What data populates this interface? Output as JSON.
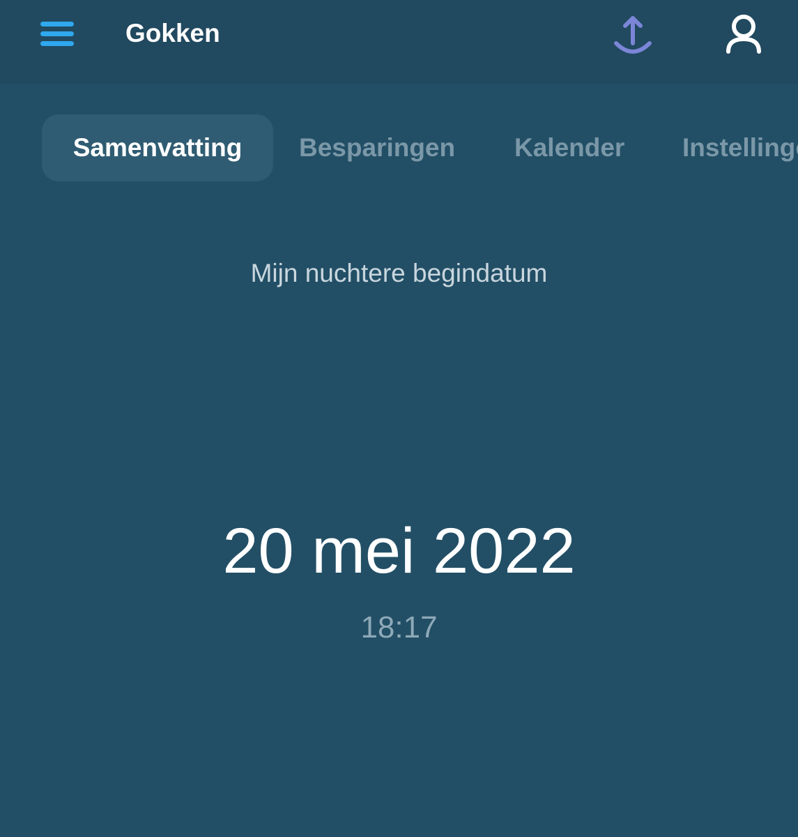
{
  "header": {
    "title": "Gokken",
    "menu_icon": "hamburger-menu-icon",
    "share_icon": "upload-share-icon",
    "profile_icon": "user-profile-icon"
  },
  "tabs": [
    {
      "label": "Samenvatting",
      "active": true
    },
    {
      "label": "Besparingen",
      "active": false
    },
    {
      "label": "Kalender",
      "active": false
    },
    {
      "label": "Instellingen",
      "active": false
    }
  ],
  "summary": {
    "label": "Mijn nuchtere begindatum",
    "date": "20 mei 2022",
    "time": "18:17"
  },
  "colors": {
    "background": "#224f66",
    "topbar": "#21495f",
    "menu_accent": "#2fa8ee",
    "share_accent": "#7b86d8",
    "active_tab_bg": "#2f5c72",
    "inactive_tab_text": "#7b98a8"
  }
}
